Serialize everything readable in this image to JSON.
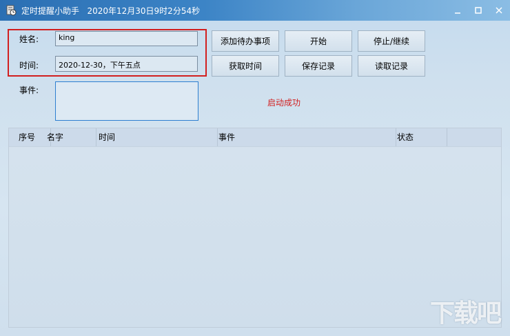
{
  "window": {
    "title": "定时提醒小助手",
    "datetime": "2020年12月30日9时2分54秒",
    "minimize_icon": "minimize-icon",
    "maximize_icon": "maximize-icon",
    "close_icon": "close-icon"
  },
  "form": {
    "name_label": "姓名:",
    "name_value": "king",
    "time_label": "时间:",
    "time_value": "2020-12-30，下午五点",
    "event_label": "事件:",
    "event_value": ""
  },
  "buttons": {
    "add_todo": "添加待办事项",
    "start": "开始",
    "stop_continue": "停止/继续",
    "get_time": "获取时间",
    "save_record": "保存记录",
    "read_record": "读取记录"
  },
  "status": {
    "text": "启动成功",
    "color": "#d22020"
  },
  "table": {
    "columns": [
      "序号",
      "名字",
      "时间",
      "事件",
      "状态"
    ],
    "rows": []
  },
  "highlight_color": "#d21e1e",
  "watermark": "下载吧"
}
